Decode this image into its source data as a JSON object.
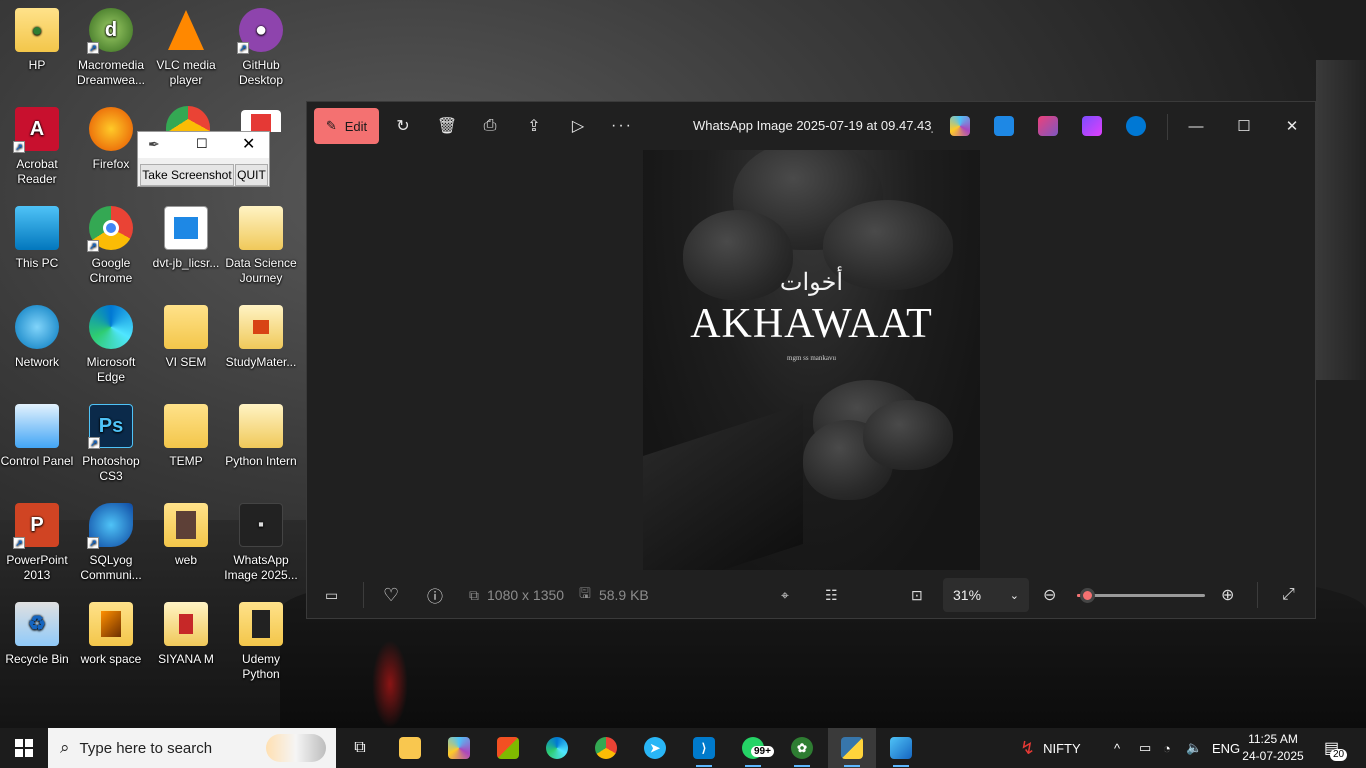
{
  "desktop": {
    "icons": [
      {
        "label": "HP",
        "icon": "folder-person-icon"
      },
      {
        "label": "Macromedia Dreamwea...",
        "icon": "dreamweaver-icon"
      },
      {
        "label": "VLC media player",
        "icon": "vlc-icon"
      },
      {
        "label": "GitHub Desktop",
        "icon": "github-icon"
      },
      {
        "label": "Acrobat Reader",
        "icon": "acrobat-icon"
      },
      {
        "label": "Firefox",
        "icon": "firefox-icon"
      },
      {
        "label": "This PC",
        "icon": "computer-icon"
      },
      {
        "label": "Google Chrome",
        "icon": "chrome-icon"
      },
      {
        "label": "dvt-jb_licsr...",
        "icon": "document-icon"
      },
      {
        "label": "Data Science Journey",
        "icon": "folder-icon"
      },
      {
        "label": "Network",
        "icon": "network-icon"
      },
      {
        "label": "Microsoft Edge",
        "icon": "edge-icon"
      },
      {
        "label": "VI SEM",
        "icon": "folder-icon"
      },
      {
        "label": "StudyMater...",
        "icon": "folder-icon"
      },
      {
        "label": "Control Panel",
        "icon": "control-panel-icon"
      },
      {
        "label": "Photoshop CS3",
        "icon": "photoshop-icon"
      },
      {
        "label": "TEMP",
        "icon": "folder-icon"
      },
      {
        "label": "Python Intern",
        "icon": "folder-icon"
      },
      {
        "label": "PowerPoint 2013",
        "icon": "powerpoint-icon"
      },
      {
        "label": "SQLyog Communi...",
        "icon": "sqlyog-icon"
      },
      {
        "label": "web",
        "icon": "folder-icon"
      },
      {
        "label": "WhatsApp Image 2025...",
        "icon": "image-thumbnail-icon"
      },
      {
        "label": "Recycle Bin",
        "icon": "recycle-bin-icon"
      },
      {
        "label": "work space",
        "icon": "folder-icon"
      },
      {
        "label": "SIYANA M",
        "icon": "folder-icon"
      },
      {
        "label": "Udemy Python",
        "icon": "folder-icon"
      }
    ]
  },
  "mini_window": {
    "screenshot_label": "Take Screenshot",
    "quit_label": "QUIT"
  },
  "photos": {
    "edit_label": "Edit",
    "title": "WhatsApp Image 2025-07-19 at 09.47.43_b...",
    "image": {
      "arabic": "أخوات",
      "title": "AKHAWAAT",
      "subtitle": "mgm ss mankavu"
    },
    "dimensions": "1080 x 1350",
    "file_size": "58.9 KB",
    "zoom": "31%",
    "zoom_fraction": 0.08,
    "accent": "#f47171"
  },
  "taskbar": {
    "search_placeholder": "Type here to search",
    "whatsapp_badge": "99+",
    "stock_label": "NIFTY",
    "language": "ENG",
    "time": "11:25 AM",
    "date": "24-07-2025",
    "notifications": "20"
  }
}
